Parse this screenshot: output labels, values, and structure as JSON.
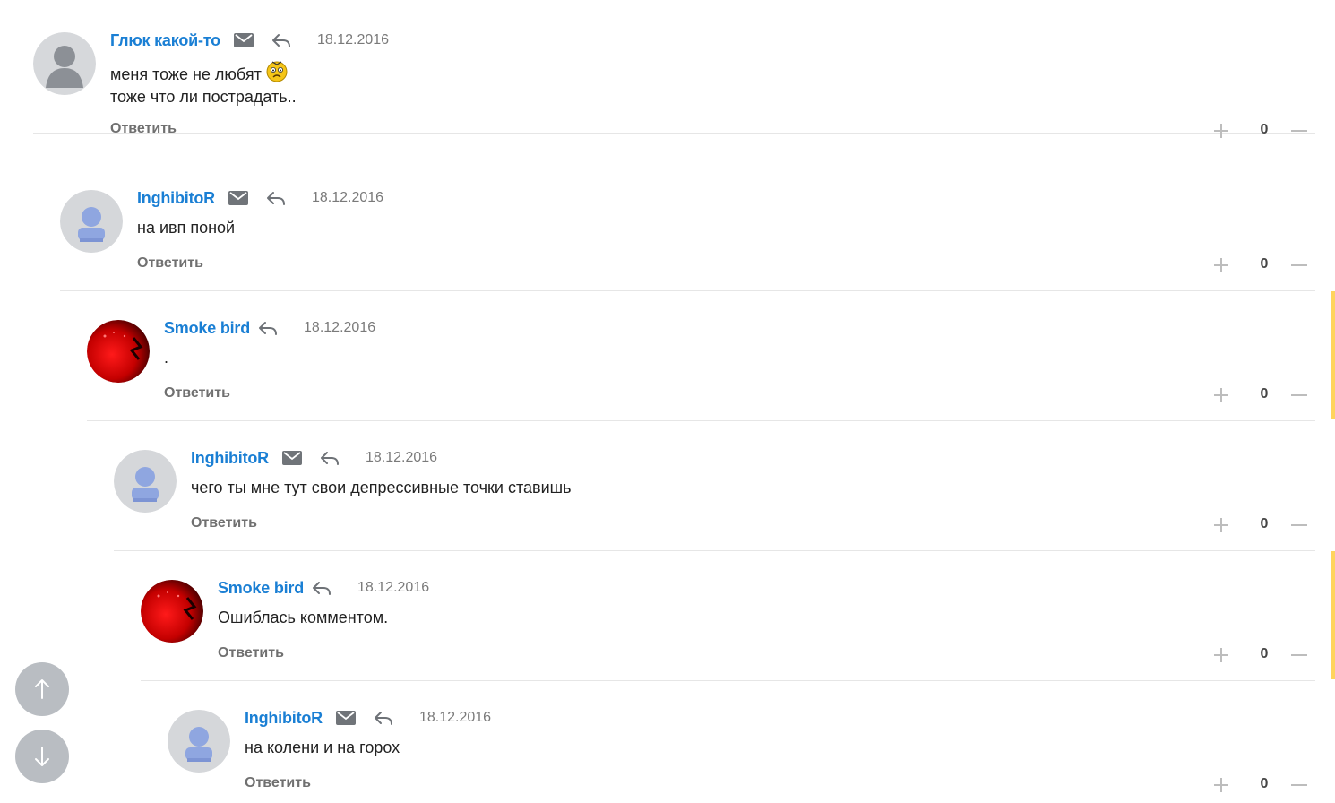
{
  "comments": [
    {
      "author": "Глюк какой-то",
      "date": "18.12.2016",
      "avatar": "default-gray-avatar",
      "has_mail": true,
      "lines": [
        "меня тоже не любят",
        "тоже что ли пострадать.."
      ],
      "has_smiley": true,
      "reply_label": "Ответить",
      "score": "0"
    },
    {
      "author": "InghibitoR",
      "date": "18.12.2016",
      "avatar": "blue-person-avatar",
      "has_mail": true,
      "lines": [
        "на ивп поной"
      ],
      "reply_label": "Ответить",
      "score": "0"
    },
    {
      "author": "Smoke bird",
      "date": "18.12.2016",
      "avatar": "red-photo-avatar",
      "has_mail": false,
      "lines": [
        "."
      ],
      "reply_label": "Ответить",
      "score": "0"
    },
    {
      "author": "InghibitoR",
      "date": "18.12.2016",
      "avatar": "blue-person-avatar",
      "has_mail": true,
      "lines": [
        "чего ты мне тут свои депрессивные точки ставишь"
      ],
      "reply_label": "Ответить",
      "score": "0"
    },
    {
      "author": "Smoke bird",
      "date": "18.12.2016",
      "avatar": "red-photo-avatar",
      "has_mail": false,
      "lines": [
        "Ошиблась комментом."
      ],
      "reply_label": "Ответить",
      "score": "0"
    },
    {
      "author": "InghibitoR",
      "date": "18.12.2016",
      "avatar": "blue-person-avatar",
      "has_mail": true,
      "lines": [
        "на колени и на горох"
      ],
      "reply_label": "Ответить",
      "score": "0"
    }
  ],
  "colors": {
    "author_link": "#1a7fd4",
    "highlight_bar": "#ffd45c",
    "nav_button": "#b9bdc2"
  },
  "nav": {
    "up_icon": "arrow-up-icon",
    "down_icon": "arrow-down-icon"
  }
}
